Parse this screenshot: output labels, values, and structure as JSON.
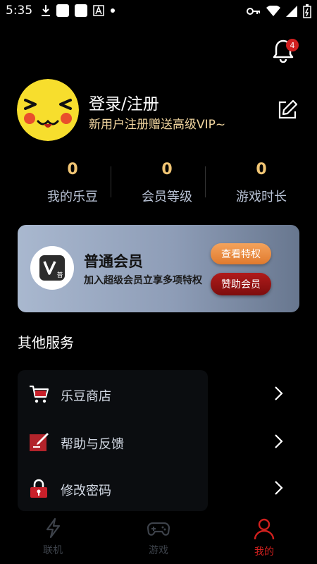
{
  "status_bar": {
    "time": "5:35"
  },
  "notifications": {
    "badge_count": "4"
  },
  "profile": {
    "title": "登录/注册",
    "subtitle": "新用户注册赠送高级VIP~"
  },
  "stats": [
    {
      "value": "0",
      "label": "我的乐豆"
    },
    {
      "value": "0",
      "label": "会员等级"
    },
    {
      "value": "0",
      "label": "游戏时长"
    }
  ],
  "vip_card": {
    "logo_char": "普",
    "title": "普通会员",
    "subtitle": "加入超级会员立享多项特权",
    "view_button": "查看特权",
    "sponsor_button": "赞助会员"
  },
  "services": {
    "section_title": "其他服务",
    "items": [
      {
        "label": "乐豆商店",
        "icon": "cart-icon"
      },
      {
        "label": "帮助与反馈",
        "icon": "feedback-icon"
      },
      {
        "label": "修改密码",
        "icon": "lock-icon"
      }
    ]
  },
  "tab_bar": {
    "items": [
      {
        "label": "联机",
        "icon": "lightning-icon",
        "active": false
      },
      {
        "label": "游戏",
        "icon": "gamepad-icon",
        "active": false
      },
      {
        "label": "我的",
        "icon": "person-icon",
        "active": true
      }
    ],
    "active_color": "#d0201e",
    "inactive_color": "#3d424a"
  },
  "colors": {
    "stat_value": "#f1c574",
    "subtitle_gold": "#f3d7a0",
    "accent_red": "#b01b1b",
    "accent_orange": "#e9893a"
  }
}
